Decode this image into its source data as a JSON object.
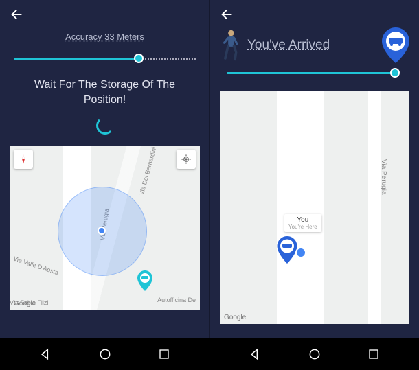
{
  "left": {
    "accuracy": "Accuracy 33 Meters",
    "wait_text": "Wait For The Storage Of The Position!",
    "streets": {
      "perugia": "Via Perugia",
      "bernardini": "Via Dei Bernardini",
      "aosta": "Via Valle D'Aosta",
      "filzi": "Via Fabio Filzi",
      "autofficina": "Autofficina De"
    },
    "google": "Google"
  },
  "right": {
    "arrived": "You've Arrived",
    "callout_title": "You",
    "callout_sub": "You're Here",
    "street": "Via Perugia",
    "google": "Google"
  },
  "colors": {
    "bg": "#1f2542",
    "accent": "#1fc4d6",
    "blue": "#4285f4"
  }
}
